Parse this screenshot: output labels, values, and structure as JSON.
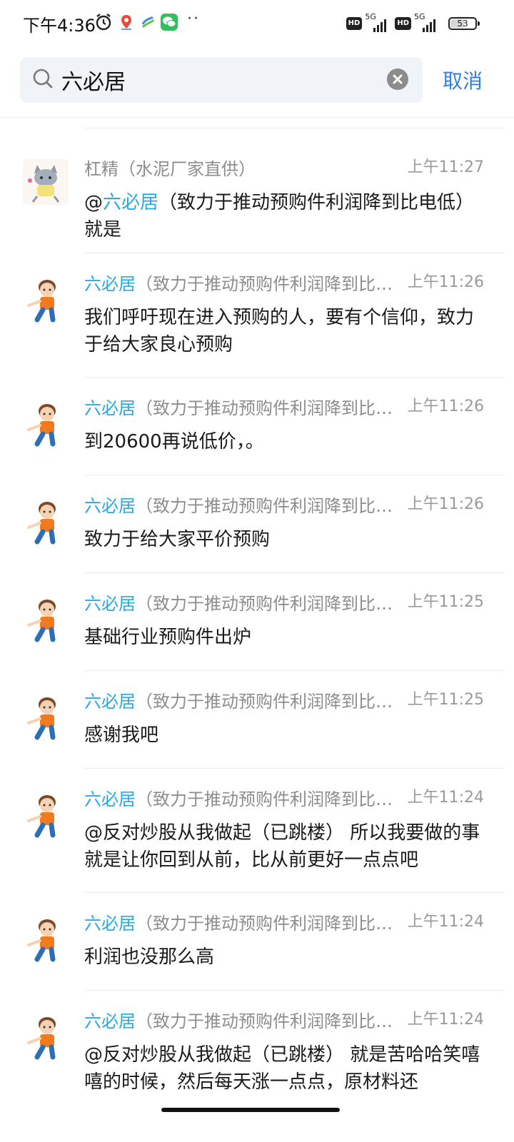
{
  "status_bar": {
    "time": "下午4:36",
    "network_1": "5G",
    "network_2": "5G",
    "hd_1": "HD",
    "hd_2": "HD",
    "battery": "53",
    "dots": "··"
  },
  "search": {
    "query": "六必居",
    "cancel_label": "取消"
  },
  "messages": [
    {
      "sender_highlight": "",
      "sender_rest": "杠精（水泥厂家直供）",
      "time": "上午11:27",
      "text_prefix": "@",
      "text_highlight": "六必居",
      "text_rest": "（致力于推动预购件利润降到比电低） 就是",
      "avatar": "cat-avatar"
    },
    {
      "sender_highlight": "六必居",
      "sender_rest": "（致力于推动预购件利润降到比…",
      "time": "上午11:26",
      "text_prefix": "",
      "text_highlight": "",
      "text_rest": "我们呼吁现在进入预购的人，要有个信仰，致力于给大家良心预购",
      "avatar": "boy-avatar"
    },
    {
      "sender_highlight": "六必居",
      "sender_rest": "（致力于推动预购件利润降到比…",
      "time": "上午11:26",
      "text_prefix": "",
      "text_highlight": "",
      "text_rest": "到20600再说低价，。",
      "avatar": "boy-avatar"
    },
    {
      "sender_highlight": "六必居",
      "sender_rest": "（致力于推动预购件利润降到比…",
      "time": "上午11:26",
      "text_prefix": "",
      "text_highlight": "",
      "text_rest": "致力于给大家平价预购",
      "avatar": "boy-avatar"
    },
    {
      "sender_highlight": "六必居",
      "sender_rest": "（致力于推动预购件利润降到比…",
      "time": "上午11:25",
      "text_prefix": "",
      "text_highlight": "",
      "text_rest": "基础行业预购件出炉",
      "avatar": "boy-avatar"
    },
    {
      "sender_highlight": "六必居",
      "sender_rest": "（致力于推动预购件利润降到比…",
      "time": "上午11:25",
      "text_prefix": "",
      "text_highlight": "",
      "text_rest": "感谢我吧",
      "avatar": "boy-avatar"
    },
    {
      "sender_highlight": "六必居",
      "sender_rest": "（致力于推动预购件利润降到比…",
      "time": "上午11:24",
      "text_prefix": "",
      "text_highlight": "",
      "text_rest": "@反对炒股从我做起（已跳楼） 所以我要做的事就是让你回到从前，比从前更好一点点吧",
      "avatar": "boy-avatar"
    },
    {
      "sender_highlight": "六必居",
      "sender_rest": "（致力于推动预购件利润降到比…",
      "time": "上午11:24",
      "text_prefix": "",
      "text_highlight": "",
      "text_rest": "利润也没那么高",
      "avatar": "boy-avatar"
    },
    {
      "sender_highlight": "六必居",
      "sender_rest": "（致力于推动预购件利润降到比…",
      "time": "上午11:24",
      "text_prefix": "",
      "text_highlight": "",
      "text_rest": "@反对炒股从我做起（已跳楼） 就是苦哈哈笑嘻嘻的时候，然后每天涨一点点，原材料还",
      "avatar": "boy-avatar"
    }
  ]
}
